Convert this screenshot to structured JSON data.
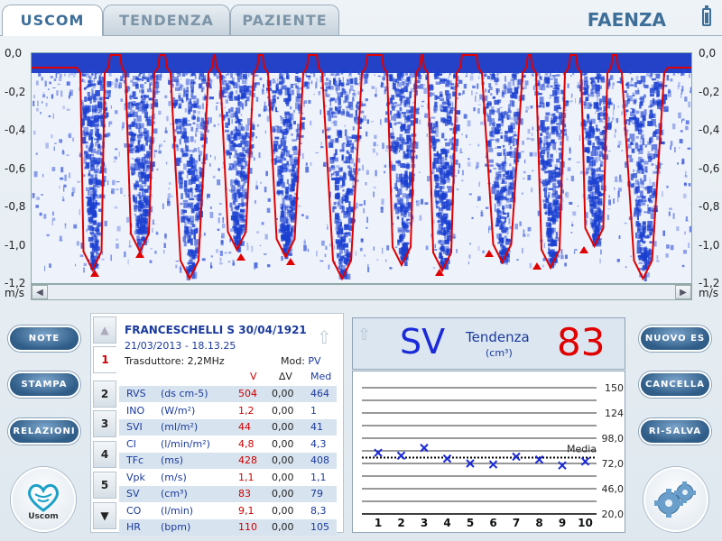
{
  "tabs": [
    {
      "label": "USCOM",
      "active": true
    },
    {
      "label": "TENDENZA",
      "active": false
    },
    {
      "label": "PAZIENTE",
      "active": false
    }
  ],
  "site": "FAENZA",
  "spectral": {
    "yaxis_labels": [
      "0,0",
      "-0,2",
      "-0,4",
      "-0,6",
      "-0,8",
      "-1,0",
      "-1,2"
    ],
    "unit": "m/s"
  },
  "side_buttons_left": [
    "NOTE",
    "STAMPA",
    "RELAZIONI"
  ],
  "side_buttons_right": [
    "NUOVO ES",
    "CANCELLA",
    "RI-SALVA"
  ],
  "logo_text": "Uscom",
  "patient": {
    "name": "FRANCESCHELLI S 30/04/1921",
    "datetime": "21/03/2013 -  18.13.25",
    "transducer": "Trasduttore: 2,2MHz",
    "mod_label": "Mod:",
    "mod_value": "PV",
    "headers": {
      "v": "V",
      "dv": "∆V",
      "med": "Med"
    },
    "rows": [
      {
        "name": "RVS",
        "unit": "(ds cm-5)",
        "v": "504",
        "dv": "0,00",
        "med": "464"
      },
      {
        "name": "INO",
        "unit": "(W/m²)",
        "v": "1,2",
        "dv": "0,00",
        "med": "1"
      },
      {
        "name": "SVI",
        "unit": "(ml/m²)",
        "v": "44",
        "dv": "0,00",
        "med": "41"
      },
      {
        "name": "CI",
        "unit": "(l/min/m²)",
        "v": "4,8",
        "dv": "0,00",
        "med": "4,3"
      },
      {
        "name": "TFc",
        "unit": "(ms)",
        "v": "428",
        "dv": "0,00",
        "med": "408"
      },
      {
        "name": "Vpk",
        "unit": "(m/s)",
        "v": "1,1",
        "dv": "0,00",
        "med": "1,1"
      },
      {
        "name": "SV",
        "unit": "(cm³)",
        "v": "83",
        "dv": "0,00",
        "med": "79"
      },
      {
        "name": "CO",
        "unit": "(l/min)",
        "v": "9,1",
        "dv": "0,00",
        "med": "8,3"
      },
      {
        "name": "HR",
        "unit": "(bpm)",
        "v": "110",
        "dv": "0,00",
        "med": "105"
      }
    ],
    "tabs": [
      "1",
      "2",
      "3",
      "4",
      "5"
    ]
  },
  "sv": {
    "label": "SV",
    "trend": "Tendenza",
    "unit": "(cm³)",
    "value": "83"
  },
  "chart_data": {
    "type": "scatter",
    "x": [
      1,
      2,
      3,
      4,
      5,
      6,
      7,
      8,
      9,
      10
    ],
    "values": [
      83,
      80,
      88,
      77,
      72,
      71,
      79,
      76,
      70,
      74
    ],
    "ytick_labels": [
      "150",
      "124",
      "98,0",
      "72,0",
      "46,0",
      "20,0"
    ],
    "yticks": [
      150,
      124,
      98,
      72,
      46,
      20
    ],
    "xtick_labels": [
      "1",
      "2",
      "3",
      "4",
      "5",
      "6",
      "7",
      "8",
      "9",
      "10"
    ],
    "ylim": [
      20,
      150
    ],
    "mean": 78,
    "mean_label": "Media",
    "colors": {
      "points": "#1a2ad8",
      "grid": "#333333"
    }
  },
  "colors": {
    "accent": "#3e6f99",
    "doppler": "#1a3fd0",
    "envelope": "#e00000",
    "value_red": "#d00000"
  }
}
